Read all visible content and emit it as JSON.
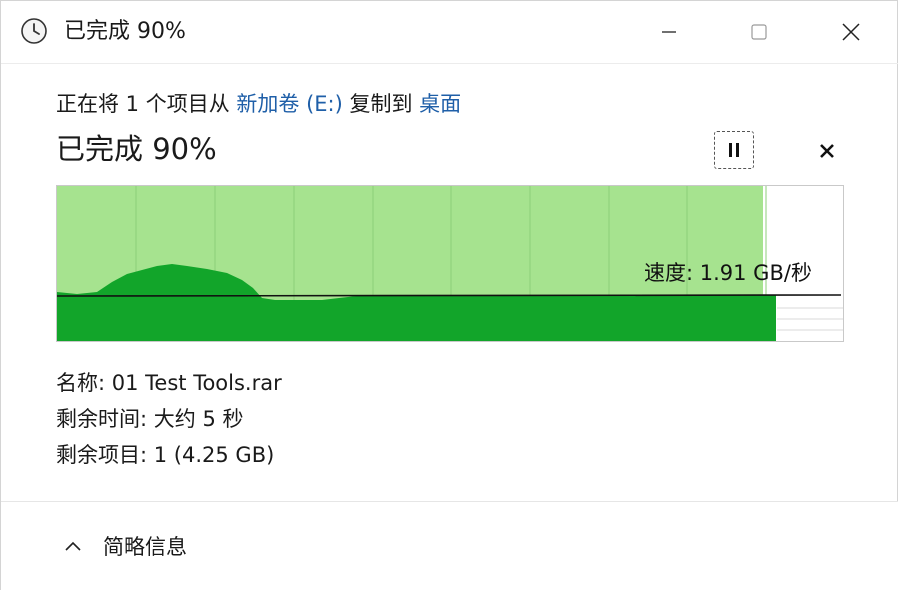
{
  "window": {
    "title": "已完成 90%",
    "icons": {
      "app": "clock-icon",
      "minimize": "minimize-icon",
      "maximize": "maximize-icon",
      "close": "close-icon"
    }
  },
  "copy": {
    "prefix": "正在将 1 个项目从 ",
    "source": "新加卷 (E:)",
    "middle": " 复制到 ",
    "destination": "桌面",
    "status": "已完成 90%",
    "pause_icon": "pause-icon",
    "cancel_icon": "cancel-x-icon"
  },
  "graph": {
    "speed_label": "速度: 1.91 GB/秒",
    "progress": 0.9,
    "colors": {
      "fill": "#a6e38f",
      "speed_area": "#12a52a",
      "line": "#111111",
      "grid": "#8ccf7a"
    }
  },
  "details": {
    "name_label": "名称: ",
    "name_value": "01 Test Tools.rar",
    "time_label": "剩余时间: ",
    "time_value": "大约 5 秒",
    "items_label": "剩余项目: ",
    "items_value": "1 (4.25 GB)"
  },
  "footer": {
    "toggle_label": "简略信息",
    "toggle_icon": "chevron-up-icon"
  }
}
